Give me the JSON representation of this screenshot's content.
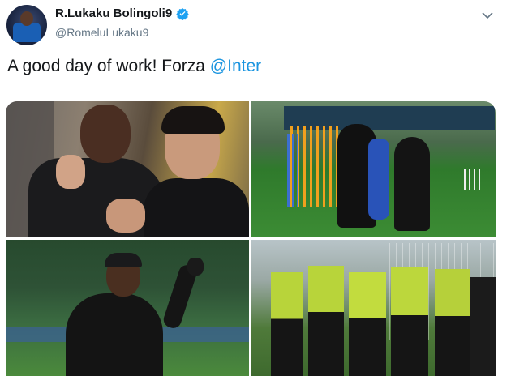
{
  "tweet": {
    "display_name": "R.Lukaku Bolingoli9",
    "handle": "@RomeluLukaku9",
    "text_prefix": "A good day of work! Forza ",
    "mention": "@Inter"
  },
  "photos": [
    {
      "name": "photo-players-hugging"
    },
    {
      "name": "photo-training-drill"
    },
    {
      "name": "photo-player-waving"
    },
    {
      "name": "photo-team-huddle"
    }
  ],
  "colors": {
    "verified_badge": "#1da1f2",
    "mention": "#1b95e0",
    "name_text": "#14171a",
    "handle_text": "#657786"
  },
  "icons": {
    "verified": "verified-badge-icon",
    "more": "chevron-down-icon"
  }
}
